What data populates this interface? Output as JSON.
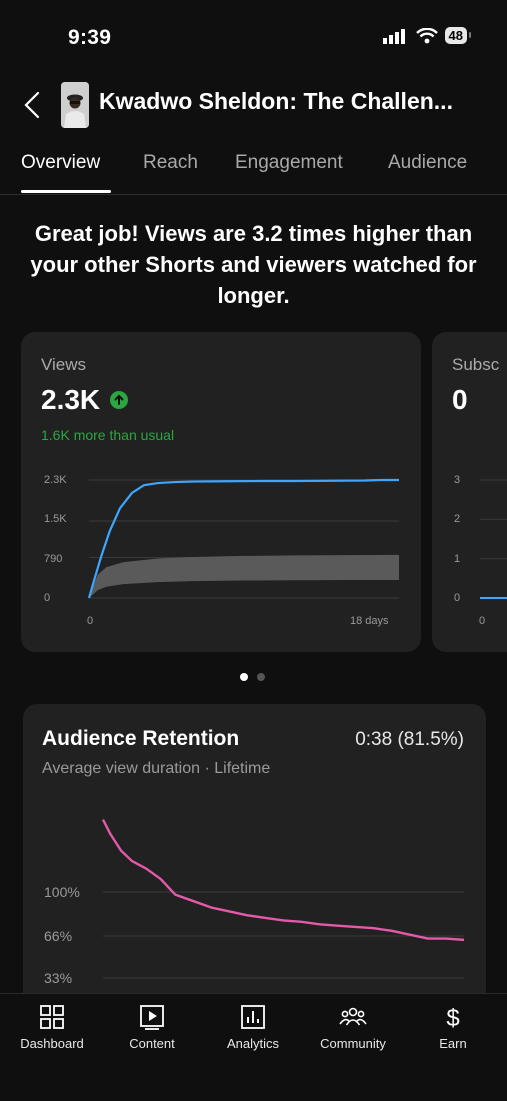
{
  "status_bar": {
    "time": "9:39",
    "battery": "48"
  },
  "header": {
    "title": "Kwadwo Sheldon: The Challen..."
  },
  "tabs": [
    {
      "label": "Overview",
      "active": true
    },
    {
      "label": "Reach",
      "active": false
    },
    {
      "label": "Engagement",
      "active": false
    },
    {
      "label": "Audience",
      "active": false
    }
  ],
  "headline": "Great job! Views are 3.2 times higher than your other Shorts and viewers watched for longer.",
  "views_card": {
    "label": "Views",
    "value": "2.3K",
    "comparison": "1.6K more than usual",
    "y_ticks": [
      "2.3K",
      "1.5K",
      "790",
      "0"
    ],
    "x_ticks": [
      "0",
      "18 days"
    ]
  },
  "subs_card": {
    "label": "Subsc",
    "value": "0",
    "y_ticks": [
      "3",
      "2",
      "1",
      "0"
    ],
    "x_ticks": [
      "0"
    ]
  },
  "pager": {
    "count": 2,
    "active": 0
  },
  "retention_card": {
    "title": "Audience Retention",
    "value": "0:38 (81.5%)",
    "subtitle": "Average view duration · Lifetime",
    "y_ticks": [
      "100%",
      "66%",
      "33%"
    ]
  },
  "bottom_nav": [
    {
      "label": "Dashboard",
      "icon": "dashboard-icon"
    },
    {
      "label": "Content",
      "icon": "content-icon"
    },
    {
      "label": "Analytics",
      "icon": "analytics-icon"
    },
    {
      "label": "Community",
      "icon": "community-icon"
    },
    {
      "label": "Earn",
      "icon": "earn-icon"
    }
  ],
  "colors": {
    "views_line": "#3ea6ff",
    "typical_band": "#5a5a5a",
    "retention_line": "#e35aa8",
    "positive": "#2ba640"
  },
  "chart_data": [
    {
      "type": "line",
      "ylabel": "Views",
      "xlabel": "",
      "y_tick_labels": [
        "0",
        "790",
        "1.5K",
        "2.3K"
      ],
      "ylim": [
        0,
        2300
      ],
      "x_tick_labels": [
        "0",
        "18 days"
      ],
      "xlim": [
        0,
        18
      ],
      "series": [
        {
          "name": "Views",
          "x": [
            0,
            0.3,
            0.7,
            1.2,
            1.8,
            2.5,
            3.2,
            4,
            5,
            6,
            8,
            10,
            12,
            14,
            16,
            17,
            18
          ],
          "values": [
            0,
            350,
            800,
            1300,
            1750,
            2050,
            2200,
            2240,
            2260,
            2270,
            2275,
            2280,
            2280,
            2285,
            2290,
            2300,
            2300
          ]
        },
        {
          "name": "Typical range upper",
          "x": [
            0,
            0.5,
            1,
            2,
            4,
            6,
            9,
            12,
            15,
            18
          ],
          "values": [
            0,
            450,
            600,
            700,
            770,
            800,
            820,
            830,
            835,
            840
          ]
        },
        {
          "name": "Typical range lower",
          "x": [
            0,
            0.5,
            1,
            2,
            4,
            6,
            9,
            12,
            15,
            18
          ],
          "values": [
            0,
            150,
            220,
            270,
            310,
            330,
            340,
            345,
            350,
            350
          ]
        }
      ]
    },
    {
      "type": "line",
      "ylabel": "Subscribers",
      "y_tick_labels": [
        "0",
        "1",
        "2",
        "3"
      ],
      "ylim": [
        0,
        3
      ],
      "x_tick_labels": [
        "0"
      ],
      "series": [
        {
          "name": "Subscribers",
          "x": [
            0,
            1
          ],
          "values": [
            0,
            0
          ]
        }
      ]
    },
    {
      "type": "line",
      "title": "Audience Retention",
      "y_tick_labels": [
        "33%",
        "66%",
        "100%"
      ],
      "ylim": [
        33,
        160
      ],
      "series": [
        {
          "name": "Retention",
          "x": [
            0,
            0.02,
            0.05,
            0.08,
            0.12,
            0.16,
            0.2,
            0.25,
            0.3,
            0.35,
            0.4,
            0.45,
            0.5,
            0.55,
            0.6,
            0.65,
            0.7,
            0.75,
            0.8,
            0.85,
            0.9,
            0.95,
            1.0
          ],
          "values": [
            156,
            145,
            132,
            124,
            118,
            110,
            98,
            93,
            88,
            85,
            82,
            80,
            78,
            77,
            75,
            74,
            73,
            72,
            70,
            67,
            64,
            64,
            63
          ]
        }
      ]
    }
  ]
}
